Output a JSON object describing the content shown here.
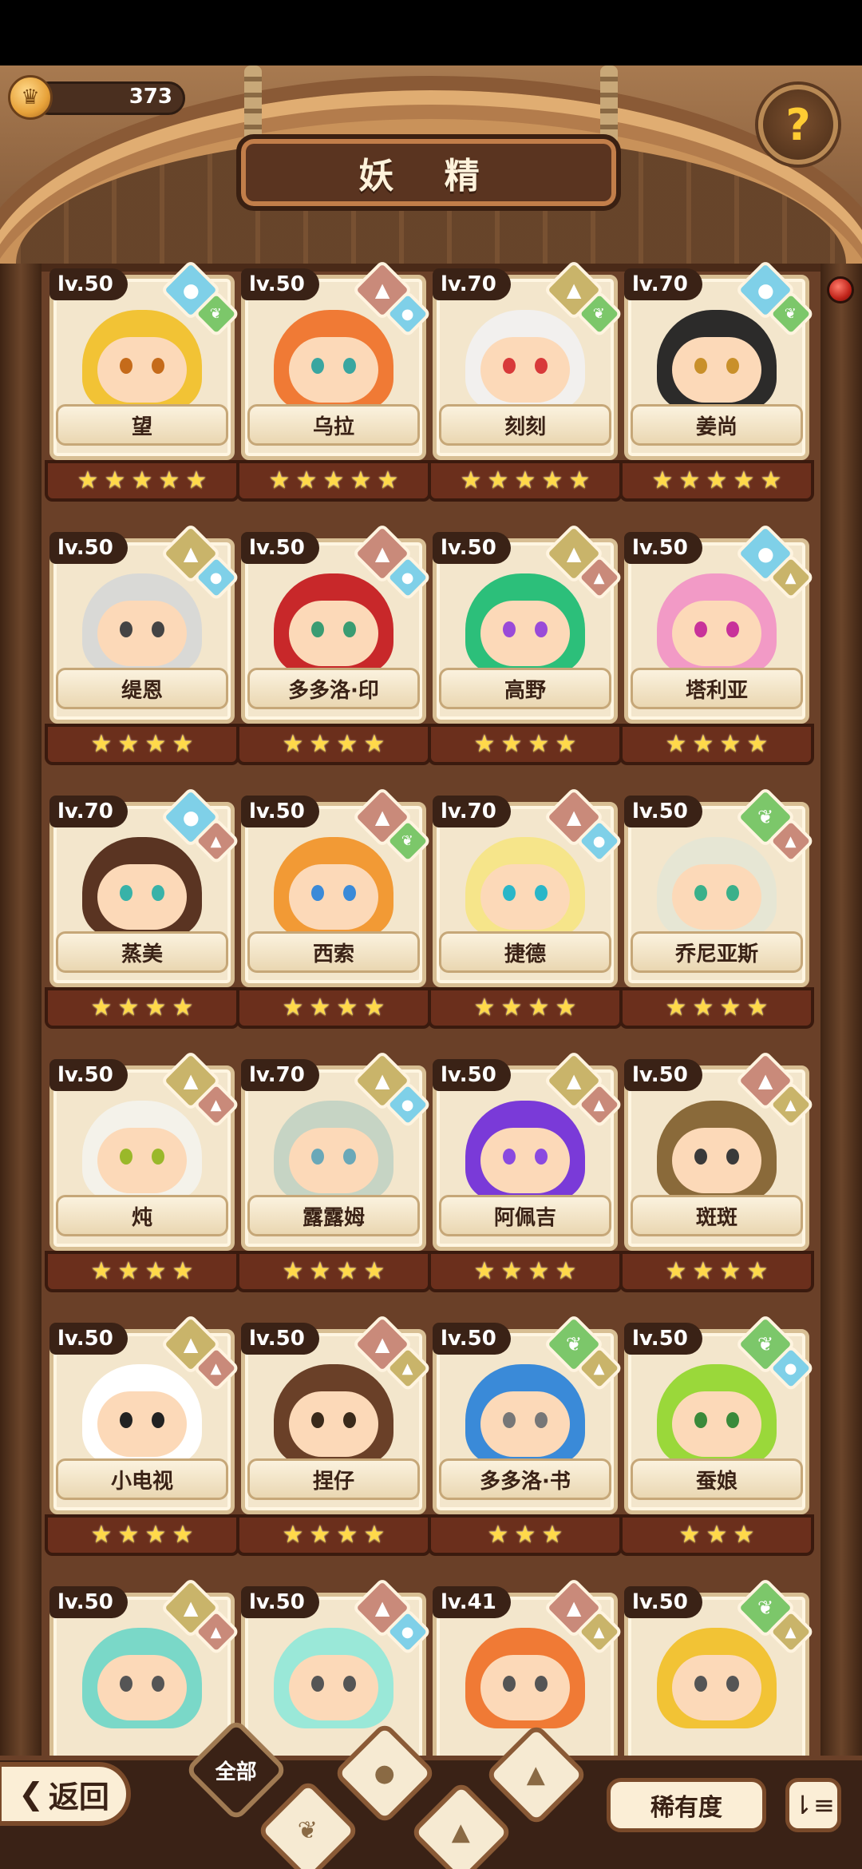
{
  "header": {
    "currency_value": "373",
    "title": "妖 精",
    "help_symbol": "?"
  },
  "colors": {
    "water": "#7fd0e8",
    "earth": "#c9b46a",
    "fire": "#c98a7a",
    "wood": "#7cc76a"
  },
  "fairies": [
    {
      "level": "lv.50",
      "name": "望",
      "stars": 5,
      "element": "water",
      "sub": "wood",
      "hair": "#f2c335",
      "eye": "#c56b1a"
    },
    {
      "level": "lv.50",
      "name": "乌拉",
      "stars": 5,
      "element": "fire",
      "sub": "water",
      "hair": "#f07a35",
      "eye": "#3aa6a0"
    },
    {
      "level": "lv.70",
      "name": "刻刻",
      "stars": 5,
      "element": "earth",
      "sub": "wood",
      "hair": "#f2f0ee",
      "eye": "#d83a3a"
    },
    {
      "level": "lv.70",
      "name": "姜尚",
      "stars": 5,
      "element": "water",
      "sub": "wood",
      "hair": "#2c2b2a",
      "eye": "#c9902a"
    },
    {
      "level": "lv.50",
      "name": "缇恩",
      "stars": 4,
      "element": "earth",
      "sub": "water",
      "hair": "#d9d9d6",
      "eye": "#444"
    },
    {
      "level": "lv.50",
      "name": "多多洛·印",
      "stars": 4,
      "element": "fire",
      "sub": "water",
      "hair": "#c8282a",
      "eye": "#3a9c72"
    },
    {
      "level": "lv.50",
      "name": "高野",
      "stars": 4,
      "element": "earth",
      "sub": "fire",
      "hair": "#2cbf7a",
      "eye": "#9a4ad8"
    },
    {
      "level": "lv.50",
      "name": "塔利亚",
      "stars": 4,
      "element": "water",
      "sub": "earth",
      "hair": "#f29ac6",
      "eye": "#c8329a"
    },
    {
      "level": "lv.70",
      "name": "蒸美",
      "stars": 4,
      "element": "water",
      "sub": "fire",
      "hair": "#5a3422",
      "eye": "#38b2a8"
    },
    {
      "level": "lv.50",
      "name": "西索",
      "stars": 4,
      "element": "fire",
      "sub": "wood",
      "hair": "#f29a35",
      "eye": "#3a8ad8"
    },
    {
      "level": "lv.70",
      "name": "捷德",
      "stars": 4,
      "element": "fire",
      "sub": "water",
      "hair": "#f6e58a",
      "eye": "#2ab6c8"
    },
    {
      "level": "lv.50",
      "name": "乔尼亚斯",
      "stars": 4,
      "element": "wood",
      "sub": "fire",
      "hair": "#e6e6d4",
      "eye": "#3ab08a"
    },
    {
      "level": "lv.50",
      "name": "炖",
      "stars": 4,
      "element": "earth",
      "sub": "fire",
      "hair": "#f4f2ea",
      "eye": "#9ab82a"
    },
    {
      "level": "lv.70",
      "name": "露露姆",
      "stars": 4,
      "element": "earth",
      "sub": "water",
      "hair": "#c6d4c4",
      "eye": "#6aa8b8"
    },
    {
      "level": "lv.50",
      "name": "阿佩吉",
      "stars": 4,
      "element": "earth",
      "sub": "fire",
      "hair": "#7a3ad8",
      "eye": "#8a4ae0"
    },
    {
      "level": "lv.50",
      "name": "斑斑",
      "stars": 4,
      "element": "fire",
      "sub": "earth",
      "hair": "#8a6a3a",
      "eye": "#3a3a3a"
    },
    {
      "level": "lv.50",
      "name": "小电视",
      "stars": 4,
      "element": "earth",
      "sub": "fire",
      "hair": "#ffffff",
      "eye": "#222"
    },
    {
      "level": "lv.50",
      "name": "捏仔",
      "stars": 4,
      "element": "fire",
      "sub": "earth",
      "hair": "#6a4028",
      "eye": "#3a2a1a"
    },
    {
      "level": "lv.50",
      "name": "多多洛·书",
      "stars": 3,
      "element": "wood",
      "sub": "earth",
      "hair": "#3a8ad8",
      "eye": "#777"
    },
    {
      "level": "lv.50",
      "name": "蚕娘",
      "stars": 3,
      "element": "wood",
      "sub": "water",
      "hair": "#9ad83a",
      "eye": "#3a8a3a"
    }
  ],
  "partial_row": [
    {
      "level": "lv.50",
      "element": "earth",
      "sub": "fire",
      "hair": "#7ad8c8"
    },
    {
      "level": "lv.50",
      "element": "fire",
      "sub": "water",
      "hair": "#9ae8d8"
    },
    {
      "level": "lv.41",
      "element": "fire",
      "sub": "earth",
      "hair": "#f07a35"
    },
    {
      "level": "lv.50",
      "element": "wood",
      "sub": "earth",
      "hair": "#f2c335"
    }
  ],
  "bottom": {
    "back_label": "返回",
    "filter_all_label": "全部",
    "sort_label": "稀有度",
    "order_symbol": "⇂≡"
  }
}
